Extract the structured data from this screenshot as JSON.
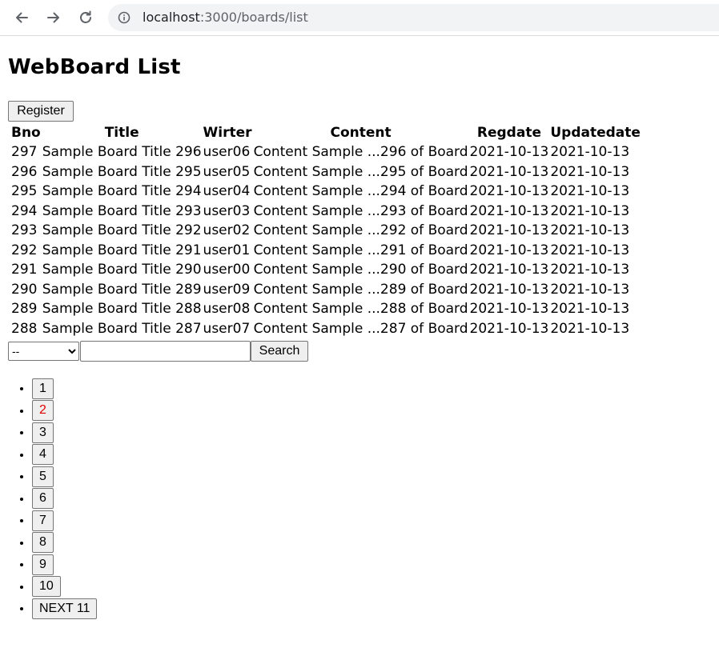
{
  "browser": {
    "url_host": "localhost",
    "url_path": ":3000/boards/list"
  },
  "page": {
    "title": "WebBoard List",
    "register_label": "Register"
  },
  "table": {
    "headers": [
      "Bno",
      "Title",
      "Wirter",
      "Content",
      "Regdate",
      "Updatedate"
    ],
    "rows": [
      [
        "297",
        "Sample Board Title 296",
        "user06",
        "Content Sample ...296 of Board",
        "2021-10-13",
        "2021-10-13"
      ],
      [
        "296",
        "Sample Board Title 295",
        "user05",
        "Content Sample ...295 of Board",
        "2021-10-13",
        "2021-10-13"
      ],
      [
        "295",
        "Sample Board Title 294",
        "user04",
        "Content Sample ...294 of Board",
        "2021-10-13",
        "2021-10-13"
      ],
      [
        "294",
        "Sample Board Title 293",
        "user03",
        "Content Sample ...293 of Board",
        "2021-10-13",
        "2021-10-13"
      ],
      [
        "293",
        "Sample Board Title 292",
        "user02",
        "Content Sample ...292 of Board",
        "2021-10-13",
        "2021-10-13"
      ],
      [
        "292",
        "Sample Board Title 291",
        "user01",
        "Content Sample ...291 of Board",
        "2021-10-13",
        "2021-10-13"
      ],
      [
        "291",
        "Sample Board Title 290",
        "user00",
        "Content Sample ...290 of Board",
        "2021-10-13",
        "2021-10-13"
      ],
      [
        "290",
        "Sample Board Title 289",
        "user09",
        "Content Sample ...289 of Board",
        "2021-10-13",
        "2021-10-13"
      ],
      [
        "289",
        "Sample Board Title 288",
        "user08",
        "Content Sample ...288 of Board",
        "2021-10-13",
        "2021-10-13"
      ],
      [
        "288",
        "Sample Board Title 287",
        "user07",
        "Content Sample ...287 of Board",
        "2021-10-13",
        "2021-10-13"
      ]
    ]
  },
  "search": {
    "type_selected": "--",
    "keyword_value": "",
    "button_label": "Search"
  },
  "pagination": {
    "pages": [
      "1",
      "2",
      "3",
      "4",
      "5",
      "6",
      "7",
      "8",
      "9",
      "10"
    ],
    "current_page": "2",
    "active_color": "#e00000",
    "next_label": "NEXT 11"
  }
}
